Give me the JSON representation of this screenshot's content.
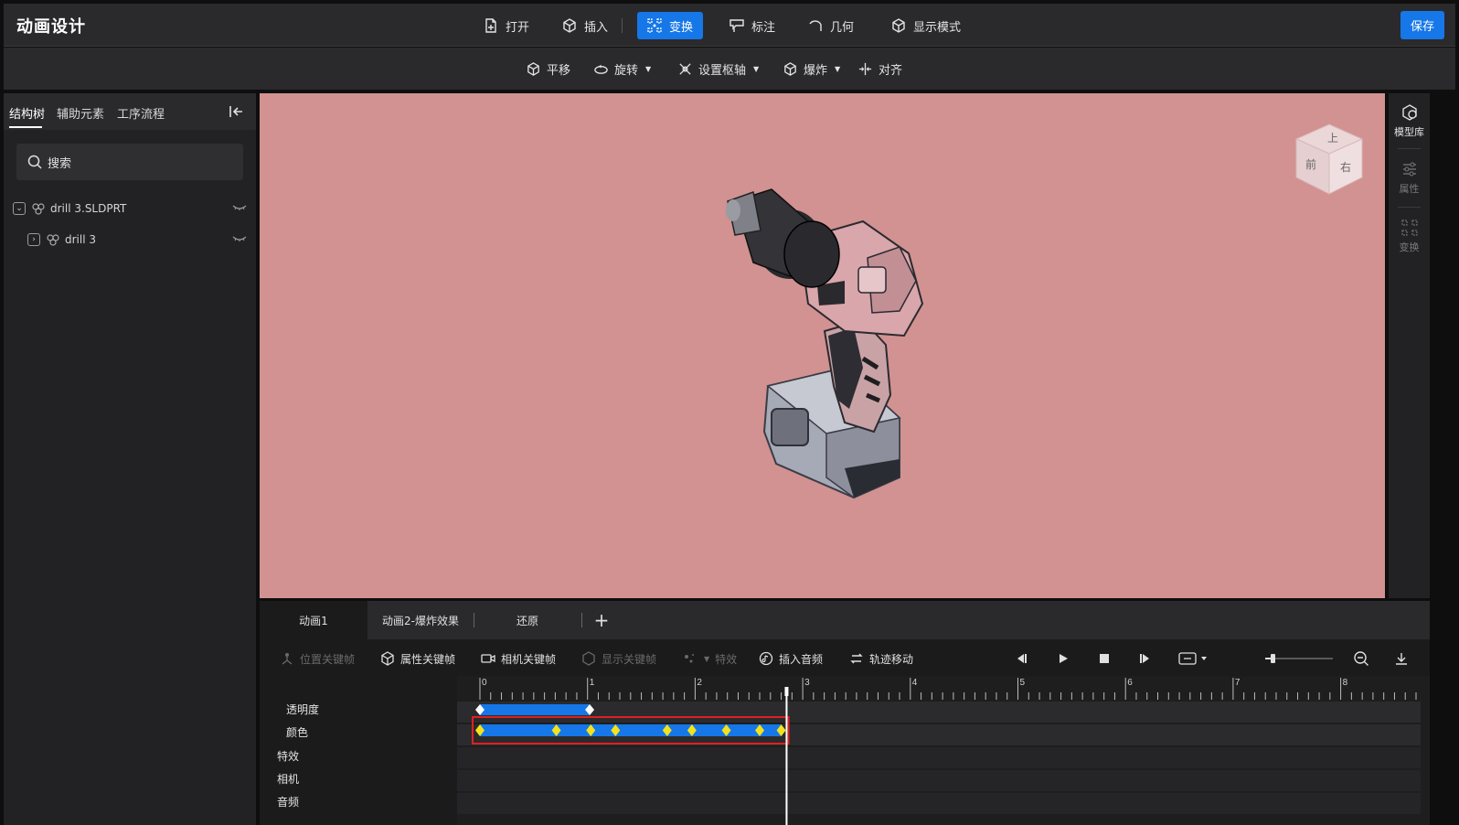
{
  "app": {
    "title": "动画设计"
  },
  "toolbar": {
    "open": "打开",
    "insert": "插入",
    "transform": "变换",
    "annotate": "标注",
    "geometry": "几何",
    "display_mode": "显示模式",
    "save": "保存",
    "active": "transform"
  },
  "subtoolbar": {
    "translate": "平移",
    "rotate": "旋转",
    "pivot": "设置枢轴",
    "explode": "爆炸",
    "align": "对齐"
  },
  "left_panel": {
    "tabs": [
      "结构树",
      "辅助元素",
      "工序流程"
    ],
    "active_tab": 0,
    "search_placeholder": "搜索",
    "tree": [
      {
        "label": "drill 3.SLDPRT",
        "expanded": true,
        "level": 0
      },
      {
        "label": "drill 3",
        "expanded": false,
        "level": 1
      }
    ]
  },
  "viewcube": {
    "top": "上",
    "front": "前",
    "right": "右"
  },
  "right_sidebar": {
    "items": [
      {
        "label": "模型库",
        "icon": "model-library-icon",
        "enabled": true
      },
      {
        "label": "属性",
        "icon": "sliders-icon",
        "enabled": false
      },
      {
        "label": "变换",
        "icon": "transform-grid-icon",
        "enabled": false
      }
    ]
  },
  "timeline": {
    "tabs": [
      "动画1",
      "动画2-爆炸效果",
      "还原"
    ],
    "active_tab": 0,
    "tools": {
      "position_key": "位置关键帧",
      "property_key": "属性关键帧",
      "camera_key": "相机关键帧",
      "display_key": "显示关键帧",
      "effects": "特效",
      "insert_audio": "插入音频",
      "track_move": "轨迹移动"
    },
    "ruler_labels": [
      "0",
      "1",
      "2",
      "3",
      "4",
      "5",
      "6",
      "7",
      "8"
    ],
    "playhead_time": 2.85,
    "tracks": [
      "透明度",
      "颜色",
      "特效",
      "相机",
      "音频"
    ],
    "opacity_keys": [
      0,
      1.02
    ],
    "color_keys": [
      0,
      0.71,
      1.03,
      1.26,
      1.74,
      1.97,
      2.29,
      2.6,
      2.8
    ],
    "colors": {
      "accent": "#1677e8",
      "selection": "#e02020",
      "keyframe": "#f5e21a"
    }
  }
}
